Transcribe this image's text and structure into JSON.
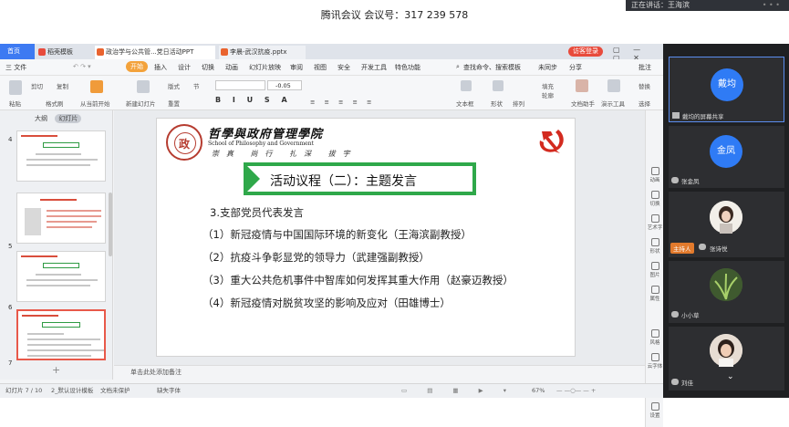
{
  "meeting": {
    "title": "腾讯会议 会议号：317 239 578",
    "speaking": "正在讲话：王海滨"
  },
  "tabs": {
    "home": "首页",
    "shell": "稻壳模板",
    "ppt1": "政治学与公共管...党日活动PPT",
    "ppt2": "李晨-武汉抗疫.pptx"
  },
  "login": "访客登录",
  "menu": {
    "file": "三 文件",
    "start": "开始",
    "items": [
      "插入",
      "设计",
      "切换",
      "动画",
      "幻灯片放映",
      "审阅",
      "视图",
      "安全",
      "开发工具",
      "特色功能"
    ],
    "search": "查找命令、搜索模板",
    "sync": "未同步",
    "share": "分享",
    "batch": "批注"
  },
  "toolbar": {
    "paste": "粘贴",
    "cut": "剪切",
    "copy": "复制",
    "format_painter": "格式刷",
    "play_from": "从当前开始",
    "new_slide": "新建幻灯片",
    "layout": "版式",
    "section": "节",
    "reset": "重置",
    "font_size_delta": "-0.05",
    "text_box": "文本框",
    "shape": "形状",
    "arrange": "排列",
    "doc_assist": "文档助手",
    "present_tools": "演示工具",
    "replace": "替换",
    "select": "选择",
    "fill": "填充",
    "outline": "轮廓"
  },
  "thumb_panel": {
    "outline_tab": "大纲",
    "slide_tab": "幻灯片",
    "numbers": [
      "4",
      "5",
      "6",
      "7"
    ],
    "add": "+"
  },
  "slide": {
    "seal_char": "政",
    "school_cn": "哲學與政府管理學院",
    "school_en": "School of Philosophy and Government",
    "school_motto": "崇真 尚行 扎深 拔宇",
    "agenda_title": "活动议程（二）：主题发言",
    "sub_heading": "3.支部党员代表发言",
    "items": [
      "（1）新冠疫情与中国国际环境的新变化（王海滨副教授）",
      "（2）抗疫斗争彰显党的领导力（武建强副教授）",
      "（3）重大公共危机事件中智库如何发挥其重大作用（赵豪迈教授）",
      "（4）新冠疫情对脱贫攻坚的影响及应对（田雄博士）"
    ]
  },
  "notes": "单击此处添加备注",
  "status": {
    "slide": "幻灯片 7 / 10",
    "template": "2_默认设计模板",
    "protect": "文档未保护",
    "font_missing": "缺失字体",
    "zoom": "67%"
  },
  "right_tools": [
    "动画",
    "切换",
    "艺术字",
    "形状",
    "图片",
    "属性",
    "风格",
    "云字体",
    "设置"
  ],
  "participants": [
    {
      "avatar": "戴均",
      "name": "戴均的屏幕共享",
      "type": "blue"
    },
    {
      "avatar": "金凤",
      "name": "张金凤",
      "type": "blue"
    },
    {
      "avatar": "",
      "name": "张诗悦",
      "type": "photo",
      "host": "主持人"
    },
    {
      "avatar": "",
      "name": "小小草",
      "type": "plant"
    },
    {
      "avatar": "",
      "name": "刘佳",
      "type": "photo"
    }
  ],
  "colors": {
    "accent": "#3d7af2",
    "green": "#2fa84a",
    "red": "#e8594a",
    "orange": "#f3a23b"
  }
}
